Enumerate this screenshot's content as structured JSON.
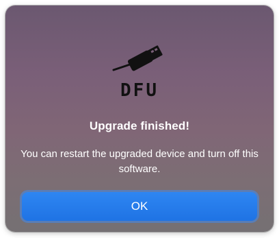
{
  "dialog": {
    "icon_name": "usb-plug-icon",
    "logo_text": "DFU",
    "title": "Upgrade finished!",
    "message": "You can restart the upgraded device and turn off this software.",
    "ok_label": "OK",
    "accent_color": "#1f73e4"
  }
}
